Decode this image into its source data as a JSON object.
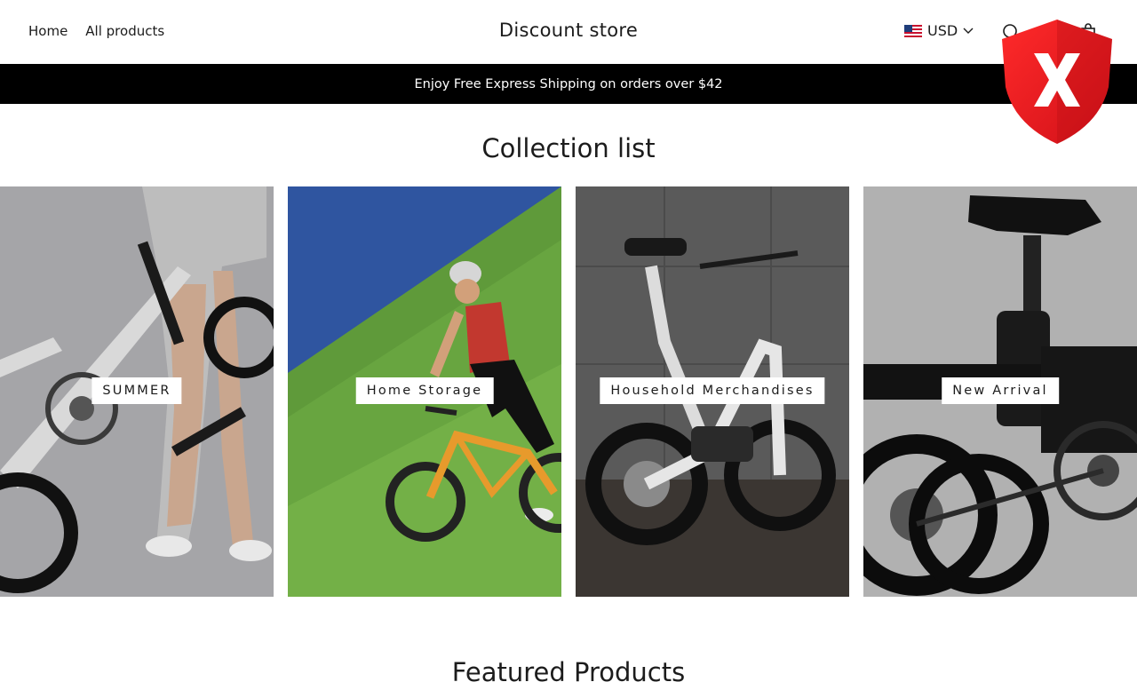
{
  "header": {
    "nav": [
      "Home",
      "All products"
    ],
    "store_title": "Discount store",
    "currency": "USD"
  },
  "announcement": "Enjoy Free Express Shipping on orders over $42",
  "collection": {
    "title": "Collection list",
    "cards": [
      {
        "label": "SUMMER"
      },
      {
        "label": "Home Storage"
      },
      {
        "label": "Household Merchandises"
      },
      {
        "label": "New Arrival"
      }
    ]
  },
  "featured": {
    "title": "Featured Products"
  },
  "colors": {
    "announcement_bg": "#000000",
    "badge_red": "#e31b23",
    "text": "#1c1c1c"
  },
  "icons": [
    "us-flag-icon",
    "chevron-down-icon",
    "search-icon",
    "cart-icon",
    "blocked-shield-icon"
  ]
}
